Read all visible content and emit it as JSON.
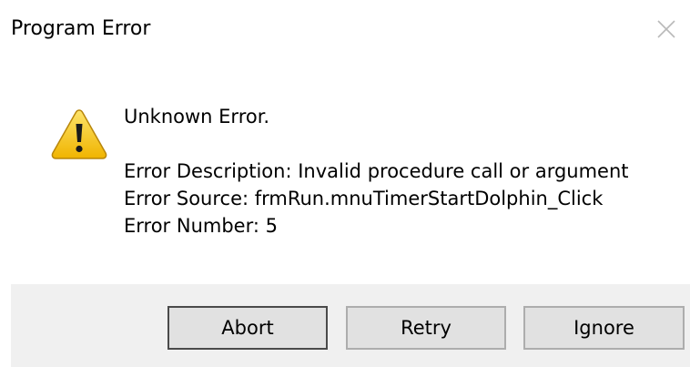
{
  "window": {
    "title": "Program Error",
    "close_icon": "close-icon"
  },
  "message": {
    "icon": "warning-icon",
    "heading": "Unknown Error.",
    "description": "Error Description: Invalid procedure call or argument",
    "source": "Error Source: frmRun.mnuTimerStartDolphin_Click",
    "number": "Error Number: 5"
  },
  "buttons": {
    "abort": "Abort",
    "retry": "Retry",
    "ignore": "Ignore"
  },
  "colors": {
    "footer_bg": "#f0f0f0",
    "button_bg": "#e1e1e1",
    "warning_yellow": "#f5c518"
  }
}
